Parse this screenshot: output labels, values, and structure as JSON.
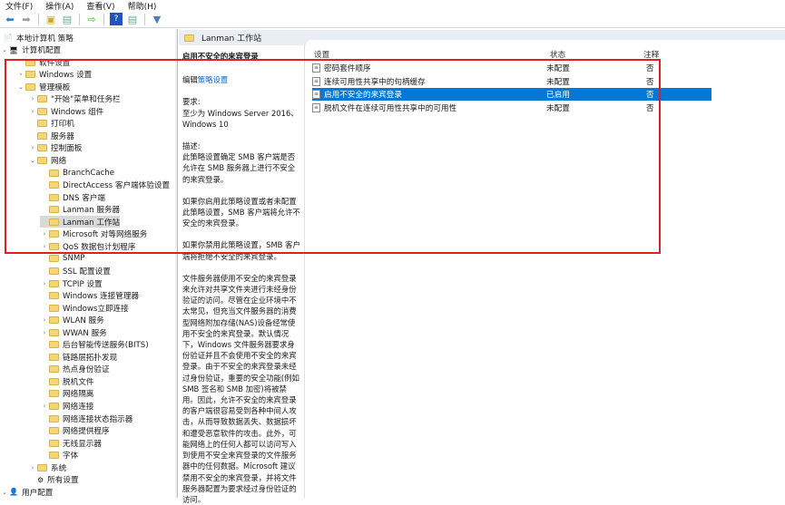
{
  "menu": [
    "文件(F)",
    "操作(A)",
    "查看(V)",
    "帮助(H)"
  ],
  "toolbar": [
    "back-icon",
    "forward-icon",
    "up-folder-icon",
    "show-hide-tree-icon",
    "export-icon",
    "help-icon",
    "properties-icon",
    "filter-icon"
  ],
  "tree": [
    {
      "label": "本地计算机 策略",
      "level": 0,
      "chev": "",
      "icon": "policy"
    },
    {
      "label": "计算机配置",
      "level": 0,
      "chev": "v",
      "icon": "computer"
    },
    {
      "label": "软件设置",
      "level": 2,
      "chev": ""
    },
    {
      "label": "Windows 设置",
      "level": 2,
      "chev": ">"
    },
    {
      "label": "管理模板",
      "level": 2,
      "chev": "v"
    },
    {
      "label": "\"开始\"菜单和任务栏",
      "level": 3,
      "chev": ">"
    },
    {
      "label": "Windows 组件",
      "level": 3,
      "chev": ">"
    },
    {
      "label": "打印机",
      "level": 3,
      "chev": ""
    },
    {
      "label": "服务器",
      "level": 3,
      "chev": ""
    },
    {
      "label": "控制面板",
      "level": 3,
      "chev": ">"
    },
    {
      "label": "网络",
      "level": 3,
      "chev": "v"
    },
    {
      "label": "BranchCache",
      "level": 4,
      "chev": ""
    },
    {
      "label": "DirectAccess 客户端体验设置",
      "level": 4,
      "chev": ""
    },
    {
      "label": "DNS 客户端",
      "level": 4,
      "chev": ""
    },
    {
      "label": "Lanman 服务器",
      "level": 4,
      "chev": ""
    },
    {
      "label": "Lanman 工作站",
      "level": 4,
      "chev": "",
      "selected": true
    },
    {
      "label": "Microsoft 对等网络服务",
      "level": 4,
      "chev": ">"
    },
    {
      "label": "QoS 数据包计划程序",
      "level": 4,
      "chev": ">"
    },
    {
      "label": "SNMP",
      "level": 4,
      "chev": ""
    },
    {
      "label": "SSL 配置设置",
      "level": 4,
      "chev": ""
    },
    {
      "label": "TCPIP 设置",
      "level": 4,
      "chev": ">"
    },
    {
      "label": "Windows 连接管理器",
      "level": 4,
      "chev": ""
    },
    {
      "label": "Windows立即连接",
      "level": 4,
      "chev": ""
    },
    {
      "label": "WLAN 服务",
      "level": 4,
      "chev": ">"
    },
    {
      "label": "WWAN 服务",
      "level": 4,
      "chev": ">"
    },
    {
      "label": "后台智能传送服务(BITS)",
      "level": 4,
      "chev": ""
    },
    {
      "label": "链路层拓扑发现",
      "level": 4,
      "chev": ""
    },
    {
      "label": "热点身份验证",
      "level": 4,
      "chev": ""
    },
    {
      "label": "脱机文件",
      "level": 4,
      "chev": ""
    },
    {
      "label": "网络隔离",
      "level": 4,
      "chev": ""
    },
    {
      "label": "网络连接",
      "level": 4,
      "chev": ">"
    },
    {
      "label": "网络连接状态指示器",
      "level": 4,
      "chev": ""
    },
    {
      "label": "网络提供程序",
      "level": 4,
      "chev": ""
    },
    {
      "label": "无线显示器",
      "level": 4,
      "chev": ""
    },
    {
      "label": "字体",
      "level": 4,
      "chev": ""
    },
    {
      "label": "系统",
      "level": 3,
      "chev": ">"
    },
    {
      "label": "所有设置",
      "level": 3,
      "chev": "",
      "icon": "settings"
    },
    {
      "label": "用户配置",
      "level": 0,
      "chev": "v",
      "icon": "user"
    }
  ],
  "header": {
    "title": "Lanman 工作站"
  },
  "desc": {
    "title": "启用不安全的来宾登录",
    "edit_prefix": "编辑",
    "edit_link": "策略设置",
    "req": "要求:\n至少为 Windows Server 2016、Windows 10",
    "p1": "描述:\n此策略设置确定 SMB 客户端是否允许在 SMB 服务器上进行不安全的来宾登录。",
    "p2": "如果你启用此策略设置或者未配置此策略设置，SMB 客户端将允许不安全的来宾登录。",
    "p3": "如果你禁用此策略设置，SMB 客户端将拒绝不安全的来宾登录。",
    "p4": "文件服务器使用不安全的来宾登录来允许对共享文件夹进行未经身份验证的访问。尽管在企业环境中不太常见，但充当文件服务器的消费型网络附加存储(NAS)设备经常使用不安全的来宾登录。默认情况下，Windows 文件服务器要求身份验证并且不会使用不安全的来宾登录。由于不安全的来宾登录未经过身份验证，重要的安全功能(例如 SMB 签名和 SMB 加密)将被禁用。因此，允许不安全的来宾登录的客户端很容易受到各种中间人攻击，从而导致数据丢失、数据损坏和遭受恶意软件的攻击。此外，可能网络上的任何人都可以访问写入到使用不安全来宾登录的文件服务器中的任何数据。Microsoft 建议禁用不安全的来宾登录，并将文件服务器配置为要求经过身份验证的访问。"
  },
  "columns": {
    "setting": "设置",
    "state": "状态",
    "comment": "注释"
  },
  "rows": [
    {
      "name": "密码套件顺序",
      "state": "未配置",
      "comment": "否"
    },
    {
      "name": "连续可用性共享中的句柄缓存",
      "state": "未配置",
      "comment": "否"
    },
    {
      "name": "启用不安全的来宾登录",
      "state": "已启用",
      "comment": "否",
      "selected": true
    },
    {
      "name": "脱机文件在连续可用性共享中的可用性",
      "state": "未配置",
      "comment": "否"
    }
  ],
  "colors": {
    "selection": "#0078d7",
    "highlight_box": "#e02020"
  }
}
